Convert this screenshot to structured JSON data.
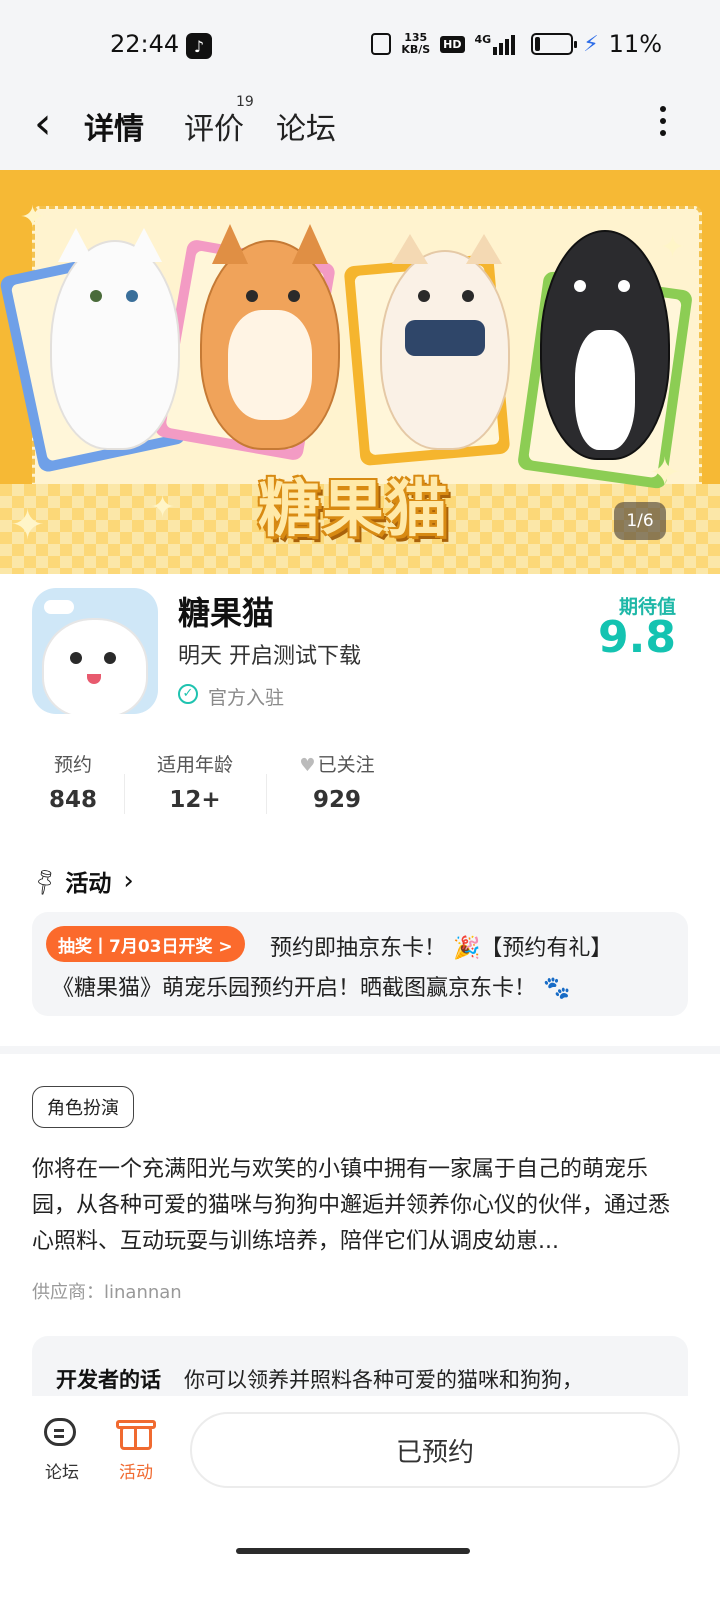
{
  "status_bar": {
    "time": "22:44",
    "speed_value": "135",
    "speed_unit": "KB/S",
    "hd_label": "HD",
    "network": "4G",
    "battery": "11%"
  },
  "nav": {
    "tabs": [
      {
        "label": "详情",
        "active": true
      },
      {
        "label": "评价",
        "badge": "19"
      },
      {
        "label": "论坛"
      }
    ]
  },
  "banner": {
    "title": "糖果猫",
    "counter": "1/6"
  },
  "app": {
    "name": "糖果猫",
    "subtitle": "明天 开启测试下载",
    "verified": "官方入驻",
    "expect_label": "期待值",
    "expect_value": "9.8"
  },
  "stats": [
    {
      "label": "预约",
      "value": "848"
    },
    {
      "label": "适用年龄",
      "value": "12+"
    },
    {
      "label": "已关注",
      "value": "929"
    }
  ],
  "activity": {
    "title": "活动",
    "tag": "抽奖丨7月03日开奖 >",
    "line1": "预约即抽京东卡！ 🎉【预约有礼】",
    "line2": "《糖果猫》萌宠乐园预约开启！晒截图赢京东卡！ 🐾"
  },
  "detail": {
    "genre": "角色扮演",
    "description": "你将在一个充满阳光与欢笑的小镇中拥有一家属于自己的萌宠乐园，从各种可爱的猫咪与狗狗中邂逅并领养你心仪的伙伴，通过悉心照料、互动玩耍与训练培养，陪伴它们从调皮幼崽...",
    "supplier": "供应商：linannan",
    "dev_title": "开发者的话",
    "dev_text": "你可以领养并照料各种可爱的猫咪和狗狗，"
  },
  "bottom": {
    "forum_label": "论坛",
    "activity_label": "活动",
    "reserve_label": "已预约"
  },
  "colors": {
    "accent": "#14c3b1",
    "activity_orange": "#fb6a2c",
    "banner_bg": "#f6b935"
  }
}
